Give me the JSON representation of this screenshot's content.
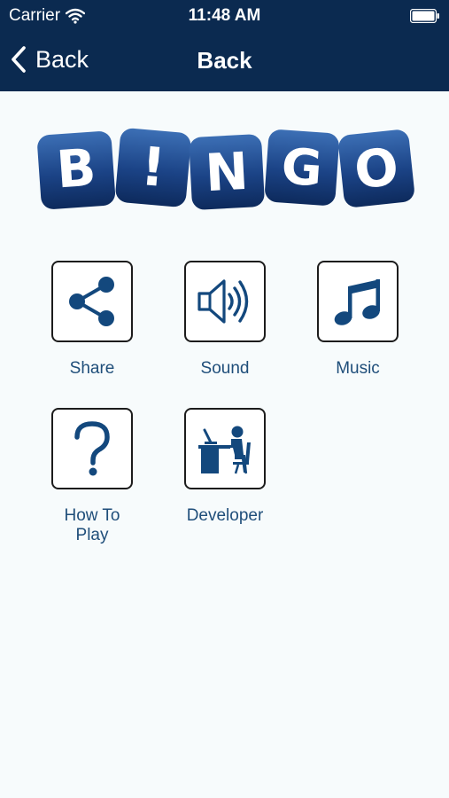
{
  "status_bar": {
    "carrier": "Carrier",
    "time": "11:48 AM"
  },
  "nav": {
    "back_label": "Back",
    "title": "Back"
  },
  "logo": {
    "letters": [
      "B",
      "!",
      "N",
      "G",
      "O"
    ]
  },
  "menu": {
    "items": [
      {
        "label": "Share",
        "icon": "share-icon"
      },
      {
        "label": "Sound",
        "icon": "speaker-icon"
      },
      {
        "label": "Music",
        "icon": "music-note-icon"
      },
      {
        "label": "How To\nPlay",
        "icon": "question-mark-icon"
      },
      {
        "label": "Developer",
        "icon": "developer-at-desk-icon"
      }
    ]
  },
  "colors": {
    "nav_background": "#0b2a50",
    "icon_blue": "#13487d",
    "label_blue": "#1f4e7a",
    "page_background": "#f7fbfc"
  }
}
